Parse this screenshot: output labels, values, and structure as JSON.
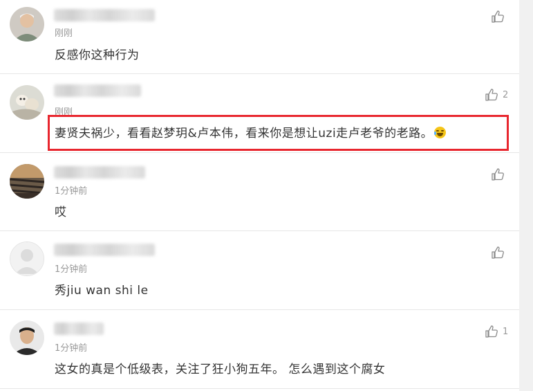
{
  "comments": [
    {
      "time": "刚刚",
      "text": "反感你这种行为",
      "likes": ""
    },
    {
      "time": "刚刚",
      "text": "妻贤夫祸少，看看赵梦玥&卢本伟，看来你是想让uzi走卢老爷的老路。",
      "likes": "2",
      "emoji": "crying-laughing-emoji-icon"
    },
    {
      "time": "1分钟前",
      "text": "哎",
      "likes": ""
    },
    {
      "time": "1分钟前",
      "text": "秀jiu wan shi le",
      "likes": ""
    },
    {
      "time": "1分钟前",
      "text": "这女的真是个低级表，关注了狂小狗五年。 怎么遇到这个腐女",
      "likes": "1"
    }
  ],
  "icons": {
    "like": "thumbs-up-icon"
  },
  "colors": {
    "highlight": "#e8262e",
    "meta": "#999999",
    "text": "#333333"
  }
}
